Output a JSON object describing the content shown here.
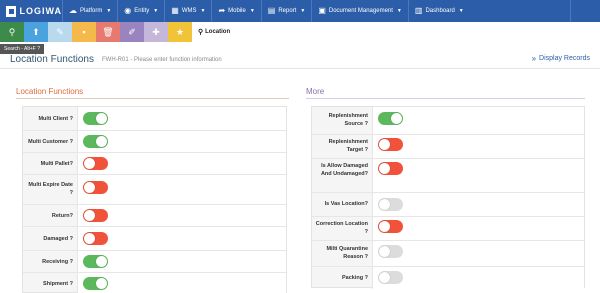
{
  "brand": {
    "name": "LOGIWA"
  },
  "nav": [
    {
      "label": "Platform",
      "icon": "cloud-icon"
    },
    {
      "label": "Entity",
      "icon": "globe-icon"
    },
    {
      "label": "WMS",
      "icon": "grid-icon"
    },
    {
      "label": "Mobile",
      "icon": "share-arrow-icon"
    },
    {
      "label": "Report",
      "icon": "report-icon"
    },
    {
      "label": "Document Management",
      "icon": "document-icon"
    },
    {
      "label": "Dashboard",
      "icon": "dashboard-icon"
    }
  ],
  "toolbar": {
    "buttons": [
      {
        "icon": "search-icon",
        "color": "#3d8b4a"
      },
      {
        "icon": "upload-icon",
        "color": "#4aa3df"
      },
      {
        "icon": "edit-icon",
        "color": "#b8d9ee"
      },
      {
        "icon": "save-icon",
        "color": "#f5b84a"
      },
      {
        "icon": "delete-icon",
        "color": "#e77a6f"
      },
      {
        "icon": "eraser-icon",
        "color": "#9a84c0"
      },
      {
        "icon": "move-icon",
        "color": "#c4b7da"
      },
      {
        "icon": "star-icon",
        "color": "#f1c338"
      }
    ],
    "location_label": "Location",
    "tooltip": "Search - Alt+F ?"
  },
  "header": {
    "title": "Location Functions",
    "subtitle": "FWH-R01 - Please enter function information",
    "display_records": "Display Records"
  },
  "sections": {
    "left_title": "Location Functions",
    "right_title": "More"
  },
  "left_fields": [
    {
      "label": "Multi Client ?",
      "state": "on"
    },
    {
      "label": "Multi Customer ?",
      "state": "on"
    },
    {
      "label": "Multi Pallet?",
      "state": "off"
    },
    {
      "label": "Multi Expire Date ?",
      "state": "off"
    },
    {
      "label": "Return?",
      "state": "off"
    },
    {
      "label": "Damaged ?",
      "state": "off"
    },
    {
      "label": "Receiving ?",
      "state": "on"
    },
    {
      "label": "Shipment ?",
      "state": "on"
    }
  ],
  "right_fields": [
    {
      "label": "Replenishment Source ?",
      "state": "on"
    },
    {
      "label": "Replenishment Target ?",
      "state": "off"
    },
    {
      "label": "Is Allow Damaged And Undamaged?",
      "state": "off"
    },
    {
      "label": "Is Vas Location?",
      "state": "disabled"
    },
    {
      "label": "Correction Location ?",
      "state": "off"
    },
    {
      "label": "Milti Quarantine Reason ?",
      "state": "disabled"
    },
    {
      "label": "Packing ?",
      "state": "disabled"
    }
  ],
  "colors": {
    "nav_bg": "#2c5da8",
    "toggle_on": "#5cb85c",
    "toggle_off": "#f0533a",
    "toggle_disabled": "#dcdcdc",
    "left_title": "#e06a3d",
    "right_title": "#8a6fa9"
  }
}
